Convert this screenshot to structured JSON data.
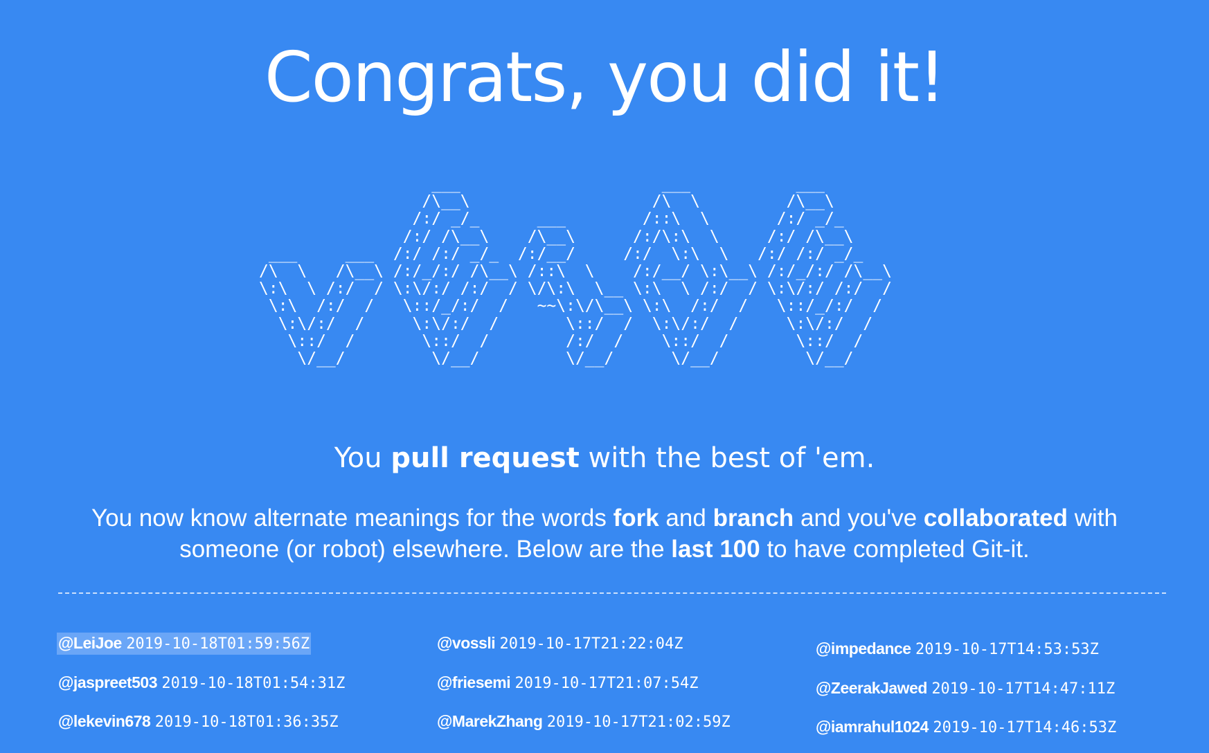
{
  "page": {
    "title": "Congrats, you did it!",
    "ascii_art": "                  ___                     ___           ___       \n                 /\\__\\                   /\\  \\         /\\__\\      \n                /:/ _/_      ___        /::\\  \\       /:/ _/_     \n               /:/ /\\__\\    /\\__\\      /:/\\:\\  \\     /:/ /\\__\\    \n ___     ___  /:/ /:/ _/_  /:/__/     /:/  \\:\\  \\   /:/ /:/ _/_   \n/\\  \\   /\\__\\ /:/_/:/ /\\__\\ /::\\  \\    /:/__/ \\:\\__\\ /:/_/:/ /\\__\\  \n\\:\\  \\ /:/  / \\:\\/:/ /:/  / \\/\\:\\  \\__ \\:\\  \\ /:/  / \\:\\/:/ /:/  /  \n \\:\\  /:/  /   \\::/_/:/  /   ~~\\:\\/\\__\\ \\:\\  /:/  /   \\::/_/:/  /   \n  \\:\\/:/  /     \\:\\/:/  /       \\::/  /  \\:\\/:/  /     \\:\\/:/  /    \n   \\::/  /       \\::/  /        /:/  /    \\::/  /       \\::/  /     \n    \\/__/         \\/__/         \\/__/      \\/__/         \\/__/      ",
    "tagline": {
      "pre": "You ",
      "bold": "pull request",
      "post": " with the best of 'em."
    },
    "description": {
      "p1": "You now know alternate meanings for the words ",
      "b1": "fork",
      "p2": " and ",
      "b2": "branch",
      "p3": " and you've ",
      "b3": "collaborated",
      "p4": " with someone (or robot) elsewhere. Below are the ",
      "b4": "last 100",
      "p5": " to have completed Git-it."
    }
  },
  "completers": [
    [
      {
        "user": "@LeiJoe",
        "time": "2019-10-18T01:59:56Z",
        "highlighted": true
      },
      {
        "user": "@jaspreet503",
        "time": "2019-10-18T01:54:31Z"
      },
      {
        "user": "@lekevin678",
        "time": "2019-10-18T01:36:35Z"
      }
    ],
    [
      {
        "user": "@vossli",
        "time": "2019-10-17T21:22:04Z"
      },
      {
        "user": "@friesemi",
        "time": "2019-10-17T21:07:54Z"
      },
      {
        "user": "@MarekZhang",
        "time": "2019-10-17T21:02:59Z"
      }
    ],
    [
      {
        "user": "@impedance",
        "time": "2019-10-17T14:53:53Z"
      },
      {
        "user": "@ZeerakJawed",
        "time": "2019-10-17T14:47:11Z"
      },
      {
        "user": "@iamrahul1024",
        "time": "2019-10-17T14:46:53Z"
      }
    ]
  ],
  "colors": {
    "background": "#3889f2",
    "text": "#ffffff",
    "highlight": "#6aa6f7"
  }
}
